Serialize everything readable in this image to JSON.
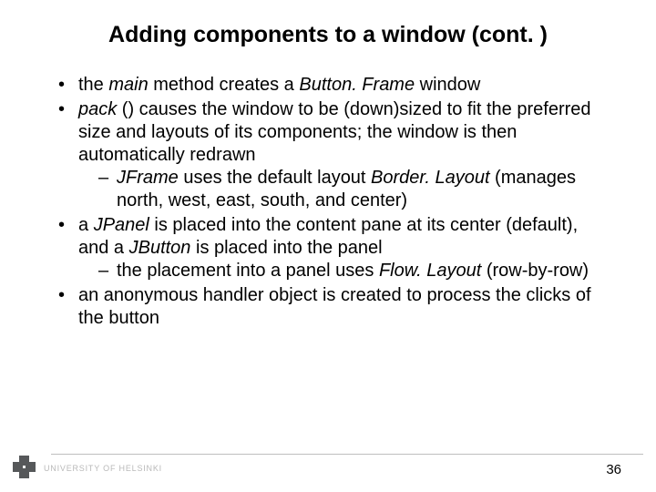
{
  "title": "Adding components to a window (cont. )",
  "bullets": {
    "b1a": "the ",
    "b1b": "main",
    "b1c": " method creates a ",
    "b1d": "Button. Frame",
    "b1e": " window",
    "b2a": "pack",
    "b2b": " () causes the window to be (down)sized to fit the preferred size and layouts of its components; the window is then automatically redrawn",
    "b2s1a": "JFrame",
    "b2s1b": " uses the default layout ",
    "b2s1c": "Border. Layout",
    "b2s1d": " (manages north, west, east, south, and center)",
    "b3a": "a ",
    "b3b": "JPanel",
    "b3c": " is placed into the content pane at its center (default), and a ",
    "b3d": "JButton",
    "b3e": " is placed into the panel",
    "b3s1a": "the placement into a panel uses ",
    "b3s1b": "Flow. Layout",
    "b3s1c": " (row-by-row)",
    "b4": "an anonymous handler object is created to process the clicks of the button"
  },
  "footer": {
    "page": "36",
    "org": "UNIVERSITY OF HELSINKI"
  }
}
